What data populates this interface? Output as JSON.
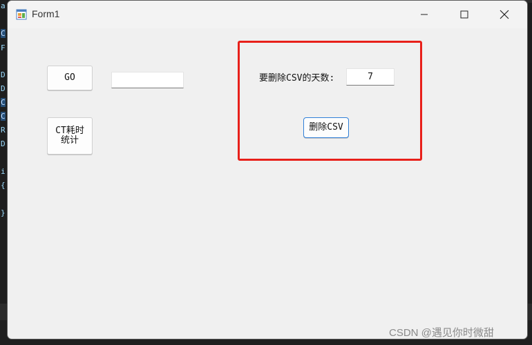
{
  "window": {
    "title": "Form1",
    "minimize_symbol": "—",
    "maximize_symbol": "☐",
    "close_symbol": "✕"
  },
  "buttons": {
    "go_label": "GO",
    "ct_stats_label": "CT耗时\n统计",
    "delete_csv_label": "删除CSV"
  },
  "inputs": {
    "go_value": "",
    "days_value": "7"
  },
  "labels": {
    "days_to_delete": "要删除CSV的天数:"
  },
  "highlight_color": "#e8201a",
  "watermark": "CSDN @遇见你时微甜",
  "editor_glyphs": [
    "a",
    "C",
    "F",
    "D",
    "D",
    "C",
    "C",
    "R",
    "D",
    "i",
    "{",
    "}"
  ]
}
